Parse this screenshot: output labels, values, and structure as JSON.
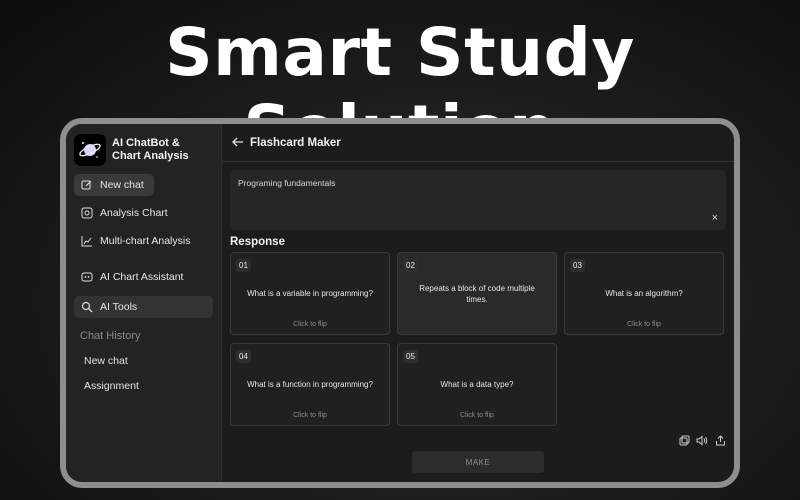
{
  "headline": "Smart Study Solution",
  "sidebar": {
    "brand_line1": "AI ChatBot &",
    "brand_line2": "Chart Analysis",
    "items": [
      {
        "label": "New chat",
        "icon": "edit-icon"
      },
      {
        "label": "Analysis Chart",
        "icon": "chart-analysis-icon"
      },
      {
        "label": "Multi-chart Analysis",
        "icon": "line-chart-icon"
      },
      {
        "label": "AI Chart Assistant",
        "icon": "assistant-icon"
      },
      {
        "label": "AI Tools",
        "icon": "search-icon"
      }
    ],
    "history_title": "Chat History",
    "history": [
      "New chat",
      "Assignment"
    ]
  },
  "main": {
    "title": "Flashcard Maker",
    "input_value": "Programing fundamentals",
    "clear_symbol": "×",
    "response_label": "Response",
    "cards": [
      {
        "num": "01",
        "text": "What is a variable in programming?",
        "hint": "Click to flip"
      },
      {
        "num": "02",
        "text": "Repeats a block of code multiple times.",
        "hint": ""
      },
      {
        "num": "03",
        "text": "What is an algorithm?",
        "hint": "Click to flip"
      },
      {
        "num": "04",
        "text": "What is a function in programming?",
        "hint": "Click to flip"
      },
      {
        "num": "05",
        "text": "What is a data type?",
        "hint": "Click to flip"
      }
    ],
    "make_label": "MAKE"
  },
  "colors": {
    "background": "#1c1c1c",
    "sidebar": "#232323",
    "frame": "#8e8e8e"
  }
}
